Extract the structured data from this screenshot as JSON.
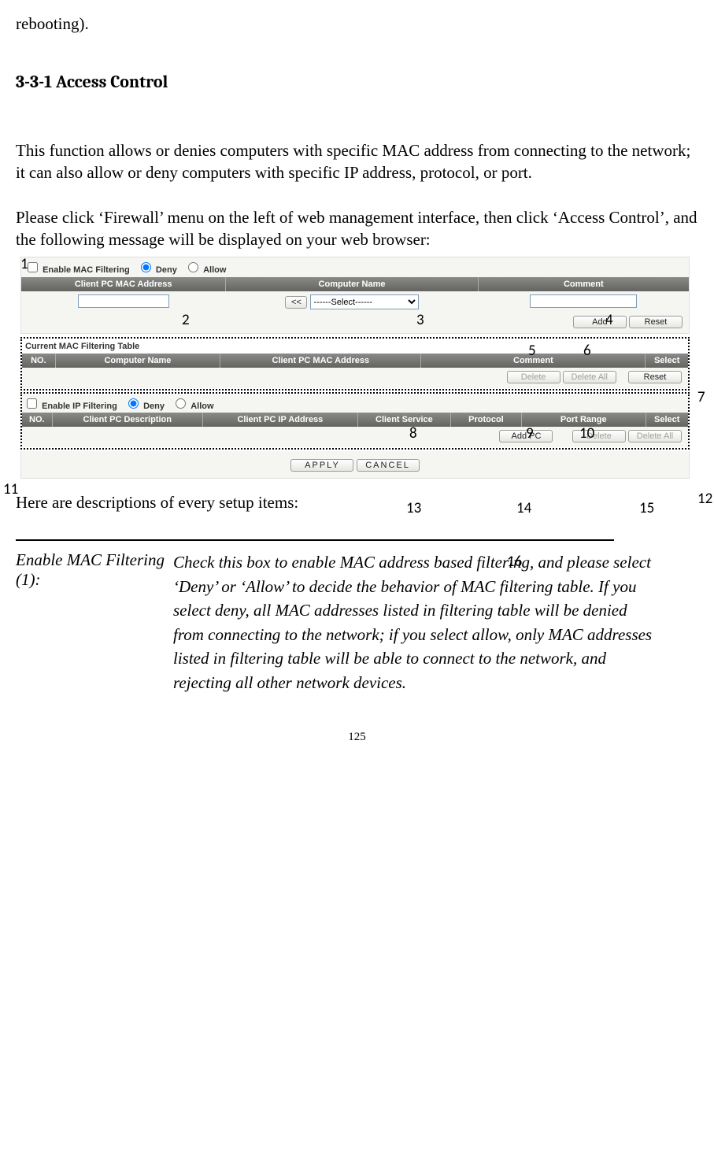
{
  "fragments": {
    "top": "rebooting)."
  },
  "heading": "3-3-1 Access Control",
  "para1": "This function allows or denies computers with specific MAC address from connecting to the network; it can also allow or deny computers with specific IP address, protocol, or port.",
  "para2": "Please click ‘Firewall’ menu on the left of web management interface, then click ‘Access Control’, and the following message will be displayed on your web browser:",
  "screenshot": {
    "mac_filter": {
      "enable_label": "Enable MAC Filtering",
      "deny_label": "Deny",
      "allow_label": "Allow",
      "headers": [
        "Client PC MAC Address",
        "Computer Name",
        "Comment"
      ],
      "mac_value": "",
      "copy_btn": "<<",
      "select_placeholder": "------Select------",
      "comment_value": "",
      "add_btn": "Add",
      "reset_btn": "Reset"
    },
    "mac_table": {
      "title": "Current MAC Filtering Table",
      "headers": [
        "NO.",
        "Computer Name",
        "Client PC MAC Address",
        "Comment",
        "Select"
      ],
      "delete_btn": "Delete",
      "delete_all_btn": "Delete All",
      "reset_btn": "Reset"
    },
    "ip_filter": {
      "enable_label": "Enable IP Filtering",
      "deny_label": "Deny",
      "allow_label": "Allow",
      "headers": [
        "NO.",
        "Client PC Description",
        "Client PC IP Address",
        "Client Service",
        "Protocol",
        "Port Range",
        "Select"
      ],
      "add_pc_btn": "Add PC",
      "delete_btn": "Delete",
      "delete_all_btn": "Delete All"
    },
    "apply_btn": "APPLY",
    "cancel_btn": "CANCEL"
  },
  "callouts": {
    "c1": "1",
    "c2": "2",
    "c3": "3",
    "c4": "4",
    "c5": "5",
    "c6": "6",
    "c7": "7",
    "c8": "8",
    "c9": "9",
    "c10": "10",
    "c11": "11",
    "c12": "12",
    "c13": "13",
    "c14": "14",
    "c15": "15",
    "c16": "16"
  },
  "lead_desc": "Here are descriptions of every setup items:",
  "items": {
    "k1": "Enable MAC Filtering (1):",
    "v1": "Check this box to enable MAC address based filtering, and please select ‘Deny’ or ‘Allow’ to decide the behavior of MAC filtering table. If you select deny, all MAC addresses listed in filtering table will be denied from connecting to the network; if you select allow, only MAC addresses listed in filtering table will be able to connect to the network, and rejecting all other network devices."
  },
  "page_number": "125"
}
